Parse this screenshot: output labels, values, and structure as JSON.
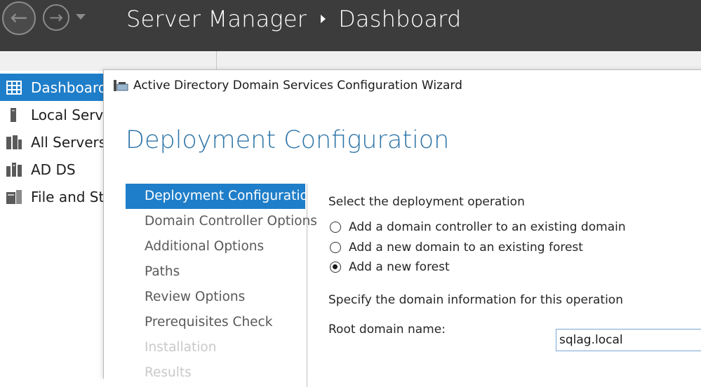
{
  "header": {
    "app_name": "Server Manager",
    "page_name": "Dashboard"
  },
  "sidebar": {
    "items": [
      {
        "label": "Dashboard",
        "icon": "dashboard-grid-icon",
        "active": true
      },
      {
        "label": "Local Server",
        "icon": "server-icon",
        "active": false
      },
      {
        "label": "All Servers",
        "icon": "servers-icon",
        "active": false
      },
      {
        "label": "AD DS",
        "icon": "ad-ds-icon",
        "active": false
      },
      {
        "label": "File and Storage Services",
        "icon": "file-storage-icon",
        "active": false
      }
    ]
  },
  "wizard": {
    "title": "Active Directory Domain Services Configuration Wizard",
    "heading": "Deployment Configuration",
    "steps": [
      {
        "label": "Deployment Configuration",
        "state": "active"
      },
      {
        "label": "Domain Controller Options",
        "state": "enabled"
      },
      {
        "label": "Additional Options",
        "state": "enabled"
      },
      {
        "label": "Paths",
        "state": "enabled"
      },
      {
        "label": "Review Options",
        "state": "enabled"
      },
      {
        "label": "Prerequisites Check",
        "state": "enabled"
      },
      {
        "label": "Installation",
        "state": "disabled"
      },
      {
        "label": "Results",
        "state": "disabled"
      }
    ],
    "operation_label": "Select the deployment operation",
    "operations": [
      {
        "label": "Add a domain controller to an existing domain",
        "selected": false
      },
      {
        "label": "Add a new domain to an existing forest",
        "selected": false
      },
      {
        "label": "Add a new forest",
        "selected": true
      }
    ],
    "domain_info_label": "Specify the domain information for this operation",
    "root_domain_label": "Root domain name:",
    "root_domain_value": "sqlag.local"
  },
  "colors": {
    "header_bg": "#3c3c3c",
    "accent": "#1f7ec9",
    "heading_blue": "#2e75a8"
  }
}
